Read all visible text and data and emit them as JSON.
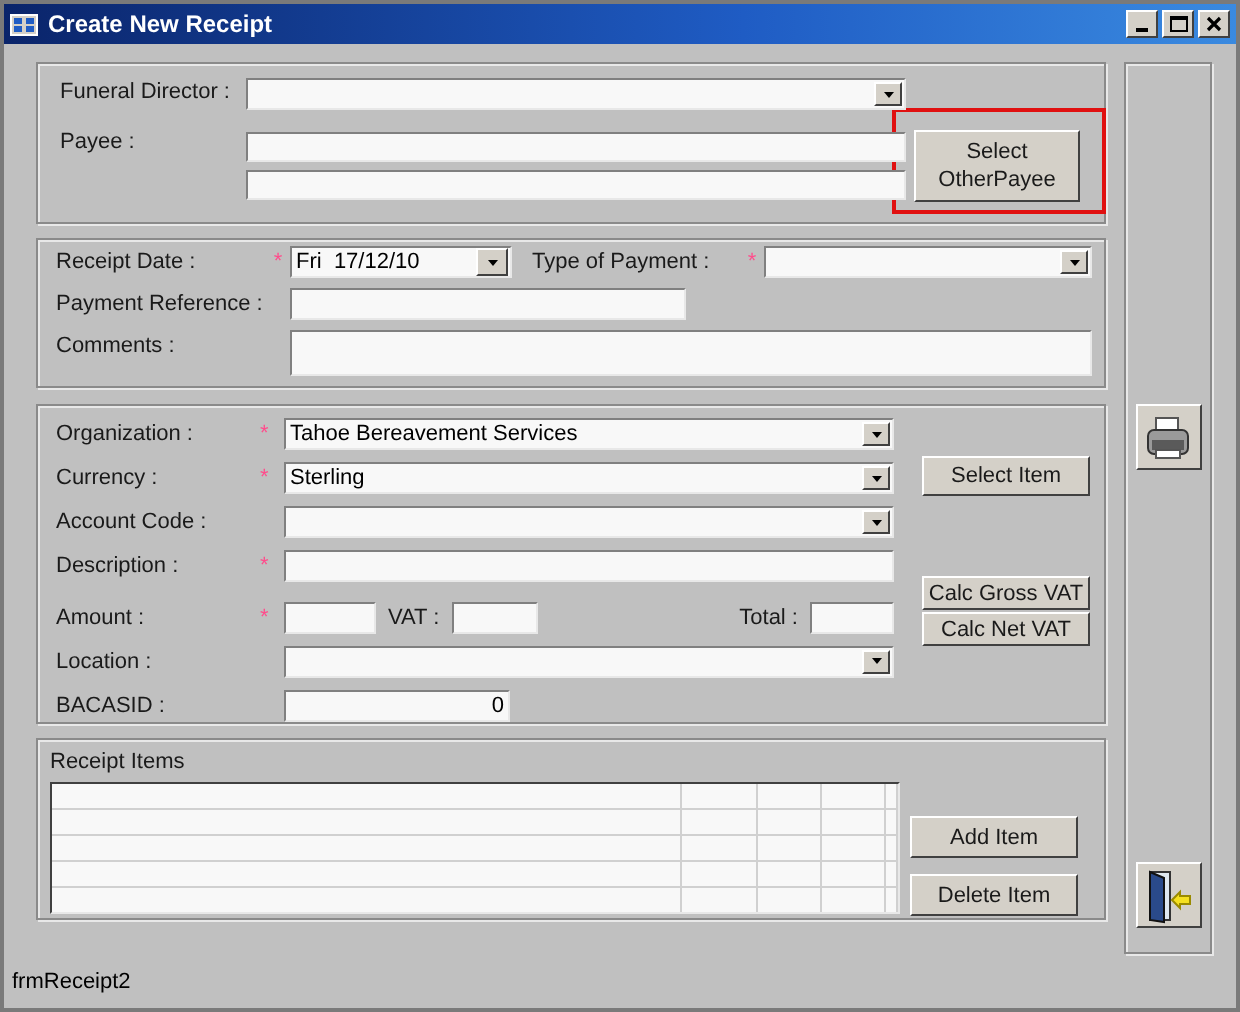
{
  "window": {
    "title": "Create New Receipt"
  },
  "payee_section": {
    "funeral_director": {
      "label": "Funeral Director :"
    },
    "payee": {
      "label": "Payee :"
    },
    "select_button": {
      "label": "Select OtherPayee",
      "highlighted": true
    }
  },
  "receipt_section": {
    "receipt_date": {
      "label": "Receipt Date :",
      "marker": "*",
      "value": "Fri  17/12/10"
    },
    "payment_type": {
      "label": "Type of Payment :",
      "marker": "*"
    },
    "payment_reference": {
      "label": "Payment Reference :"
    },
    "comments": {
      "label": "Comments :"
    }
  },
  "item_section": {
    "fields": [
      {
        "kind": "combo",
        "label": "Organization :",
        "marker": "*",
        "value": "Tahoe Bereavement Services"
      },
      {
        "kind": "combo",
        "label": "Currency :",
        "marker": "*",
        "value": "Sterling"
      },
      {
        "kind": "combo",
        "label": "Account Code :"
      },
      {
        "kind": "text",
        "label": "Description :",
        "marker": "*"
      },
      {
        "kind": "amount",
        "label": "Amount :",
        "marker": "*",
        "vat_label": "VAT :",
        "total_label": "Total :"
      },
      {
        "kind": "combo",
        "label": "Location :"
      },
      {
        "kind": "number",
        "label": "BACASID :",
        "value": "0"
      }
    ],
    "buttons": [
      {
        "label": "Select Item"
      },
      {
        "label": "Calc Gross VAT"
      },
      {
        "label": "Calc Net VAT"
      }
    ]
  },
  "receipt_items": {
    "title": "Receipt Items",
    "buttons": [
      {
        "label": "Add Item"
      },
      {
        "label": "Delete Item"
      }
    ]
  },
  "status_bar": {
    "text": "frmReceipt2"
  }
}
